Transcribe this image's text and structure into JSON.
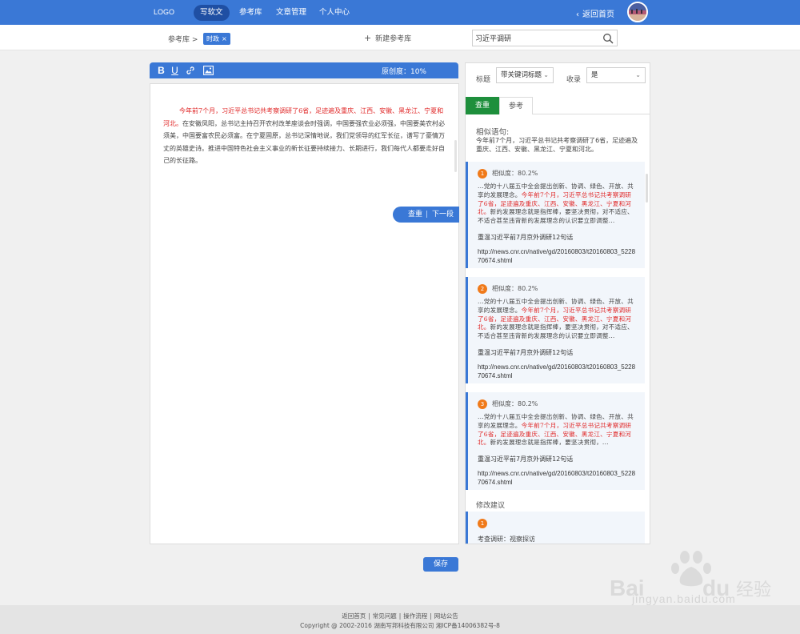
{
  "nav": {
    "logo": "LOGO",
    "items": [
      {
        "label": "写软文",
        "active": true
      },
      {
        "label": "参考库",
        "active": false
      },
      {
        "label": "文章管理",
        "active": false
      },
      {
        "label": "个人中心",
        "active": false
      }
    ],
    "back_home": "返回首页"
  },
  "subbar": {
    "breadcrumb": "参考库 >",
    "tag": "时政",
    "new_ref": "新建参考库",
    "search_value": "习近平调研"
  },
  "editor": {
    "toolbar_icons": [
      "bold-icon",
      "underline-icon",
      "link-icon",
      "image-icon"
    ],
    "originality": "原创度：10%",
    "text_highlight": "今年前7个月，习近平总书记共考察调研了6省，足迹遍及重庆、江西、安徽、黑龙江、宁夏和河北。",
    "text_rest": "在安徽凤阳，总书记主持召开农村改革座谈会时强调，中国要强农业必须强，中国要美农村必须美，中国要富农民必须富。在宁夏固原，总书记深情地说，我们党领导的红军长征，谱写了豪情万丈的英雄史诗。推进中国特色社会主义事业的新长征要持续接力、长期进行，我们每代人都要走好自己的长征路。",
    "check_label": "查重",
    "divider": "|",
    "next_label": "下一段"
  },
  "panel": {
    "title_label": "标题",
    "title_select": "带关键词标题",
    "include_label": "收录",
    "include_select": "是",
    "tabs": [
      {
        "label": "查重",
        "active": true
      },
      {
        "label": "参考",
        "active": false
      }
    ],
    "similar_heading": "相似语句:",
    "similar_text": "今年前7个月，习近平总书记共考察调研了6省，足迹遍及重庆、江西、安徽、黑龙江、宁夏和河北。",
    "results": [
      {
        "num": "1",
        "similarity": "相似度：80.2%",
        "excerpt_before": "...党的十八届五中全会提出创新、协调、绿色、开放、共享的发展理念。",
        "excerpt_hl": "今年前7个月，习近平总书记共考察调研了6省，足迹遍及重庆、江西、安徽、黑龙江、宁夏和河北。",
        "excerpt_after": "新的发展理念就是指挥棒，要坚决贯彻，对不适应、不适合甚至违背新的发展理念的认识要立即调整...",
        "source_title": "重温习近平前7月京外调研12句话",
        "source_url": "http://news.cnr.cn/native/gd/20160803/t20160803_522870674.shtml"
      },
      {
        "num": "2",
        "similarity": "相似度：80.2%",
        "excerpt_before": "...党的十八届五中全会提出创新、协调、绿色、开放、共享的发展理念。",
        "excerpt_hl": "今年前7个月，习近平总书记共考察调研了6省，足迹遍及重庆、江西、安徽、黑龙江、宁夏和河北。",
        "excerpt_after": "新的发展理念就是指挥棒，要坚决贯彻，对不适应、不适合甚至违背新的发展理念的认识要立即调整...",
        "source_title": "重温习近平前7月京外调研12句话",
        "source_url": "http://news.cnr.cn/native/gd/20160803/t20160803_522870674.shtml"
      },
      {
        "num": "3",
        "similarity": "相似度：80.2%",
        "excerpt_before": "...党的十八届五中全会提出创新、协调、绿色、开放、共享的发展理念。",
        "excerpt_hl": "今年前7个月，习近平总书记共考察调研了6省，足迹遍及重庆、江西、安徽、黑龙江、宁夏和河北。",
        "excerpt_after": "新的发展理念就是指挥棒，要坚决贯彻，...",
        "source_title": "重温习近平前7月京外调研12句话",
        "source_url": "http://news.cnr.cn/native/gd/20160803/t20160803_522870674.shtml"
      }
    ],
    "suggest_heading": "修改建议",
    "suggest_num": "1",
    "suggest_line": "考查调研：视察探访"
  },
  "save_label": "保存",
  "footer": {
    "links": [
      "返回首页",
      "常见问题",
      "操作流程",
      "网站公告"
    ],
    "copyright": "Copyright @ 2002-2016 湖南写邦科技有限公司 湘ICP备14006382号-8"
  },
  "watermark": "jingyan.baidu.com"
}
